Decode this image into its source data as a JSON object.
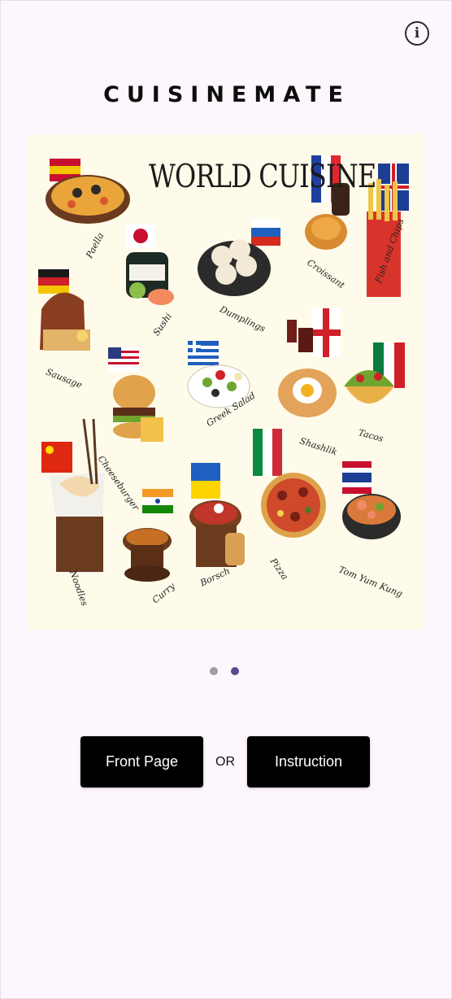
{
  "app": {
    "title": "CUISINEMATE"
  },
  "header": {
    "info_icon": "info-circle-icon",
    "info_glyph": "i"
  },
  "hero": {
    "heading": "WORLD CUISINE",
    "dishes": [
      "Paella",
      "Sushi",
      "Dumplings",
      "Croissant",
      "Fish and Chips",
      "Sausage",
      "Greek Salad",
      "Shashlik",
      "Tacos",
      "Cheeseburger",
      "Noodles",
      "Curry",
      "Borsch",
      "Pizza",
      "Tom Yum Kung"
    ]
  },
  "carousel": {
    "page_count": 2,
    "active_index": 1
  },
  "actions": {
    "front_page_label": "Front Page",
    "or_label": "OR",
    "instruction_label": "Instruction"
  },
  "colors": {
    "background": "#fdf7fd",
    "button": "#000000",
    "dot_inactive": "#9e9e9e",
    "dot_active": "#5c4a8e"
  }
}
